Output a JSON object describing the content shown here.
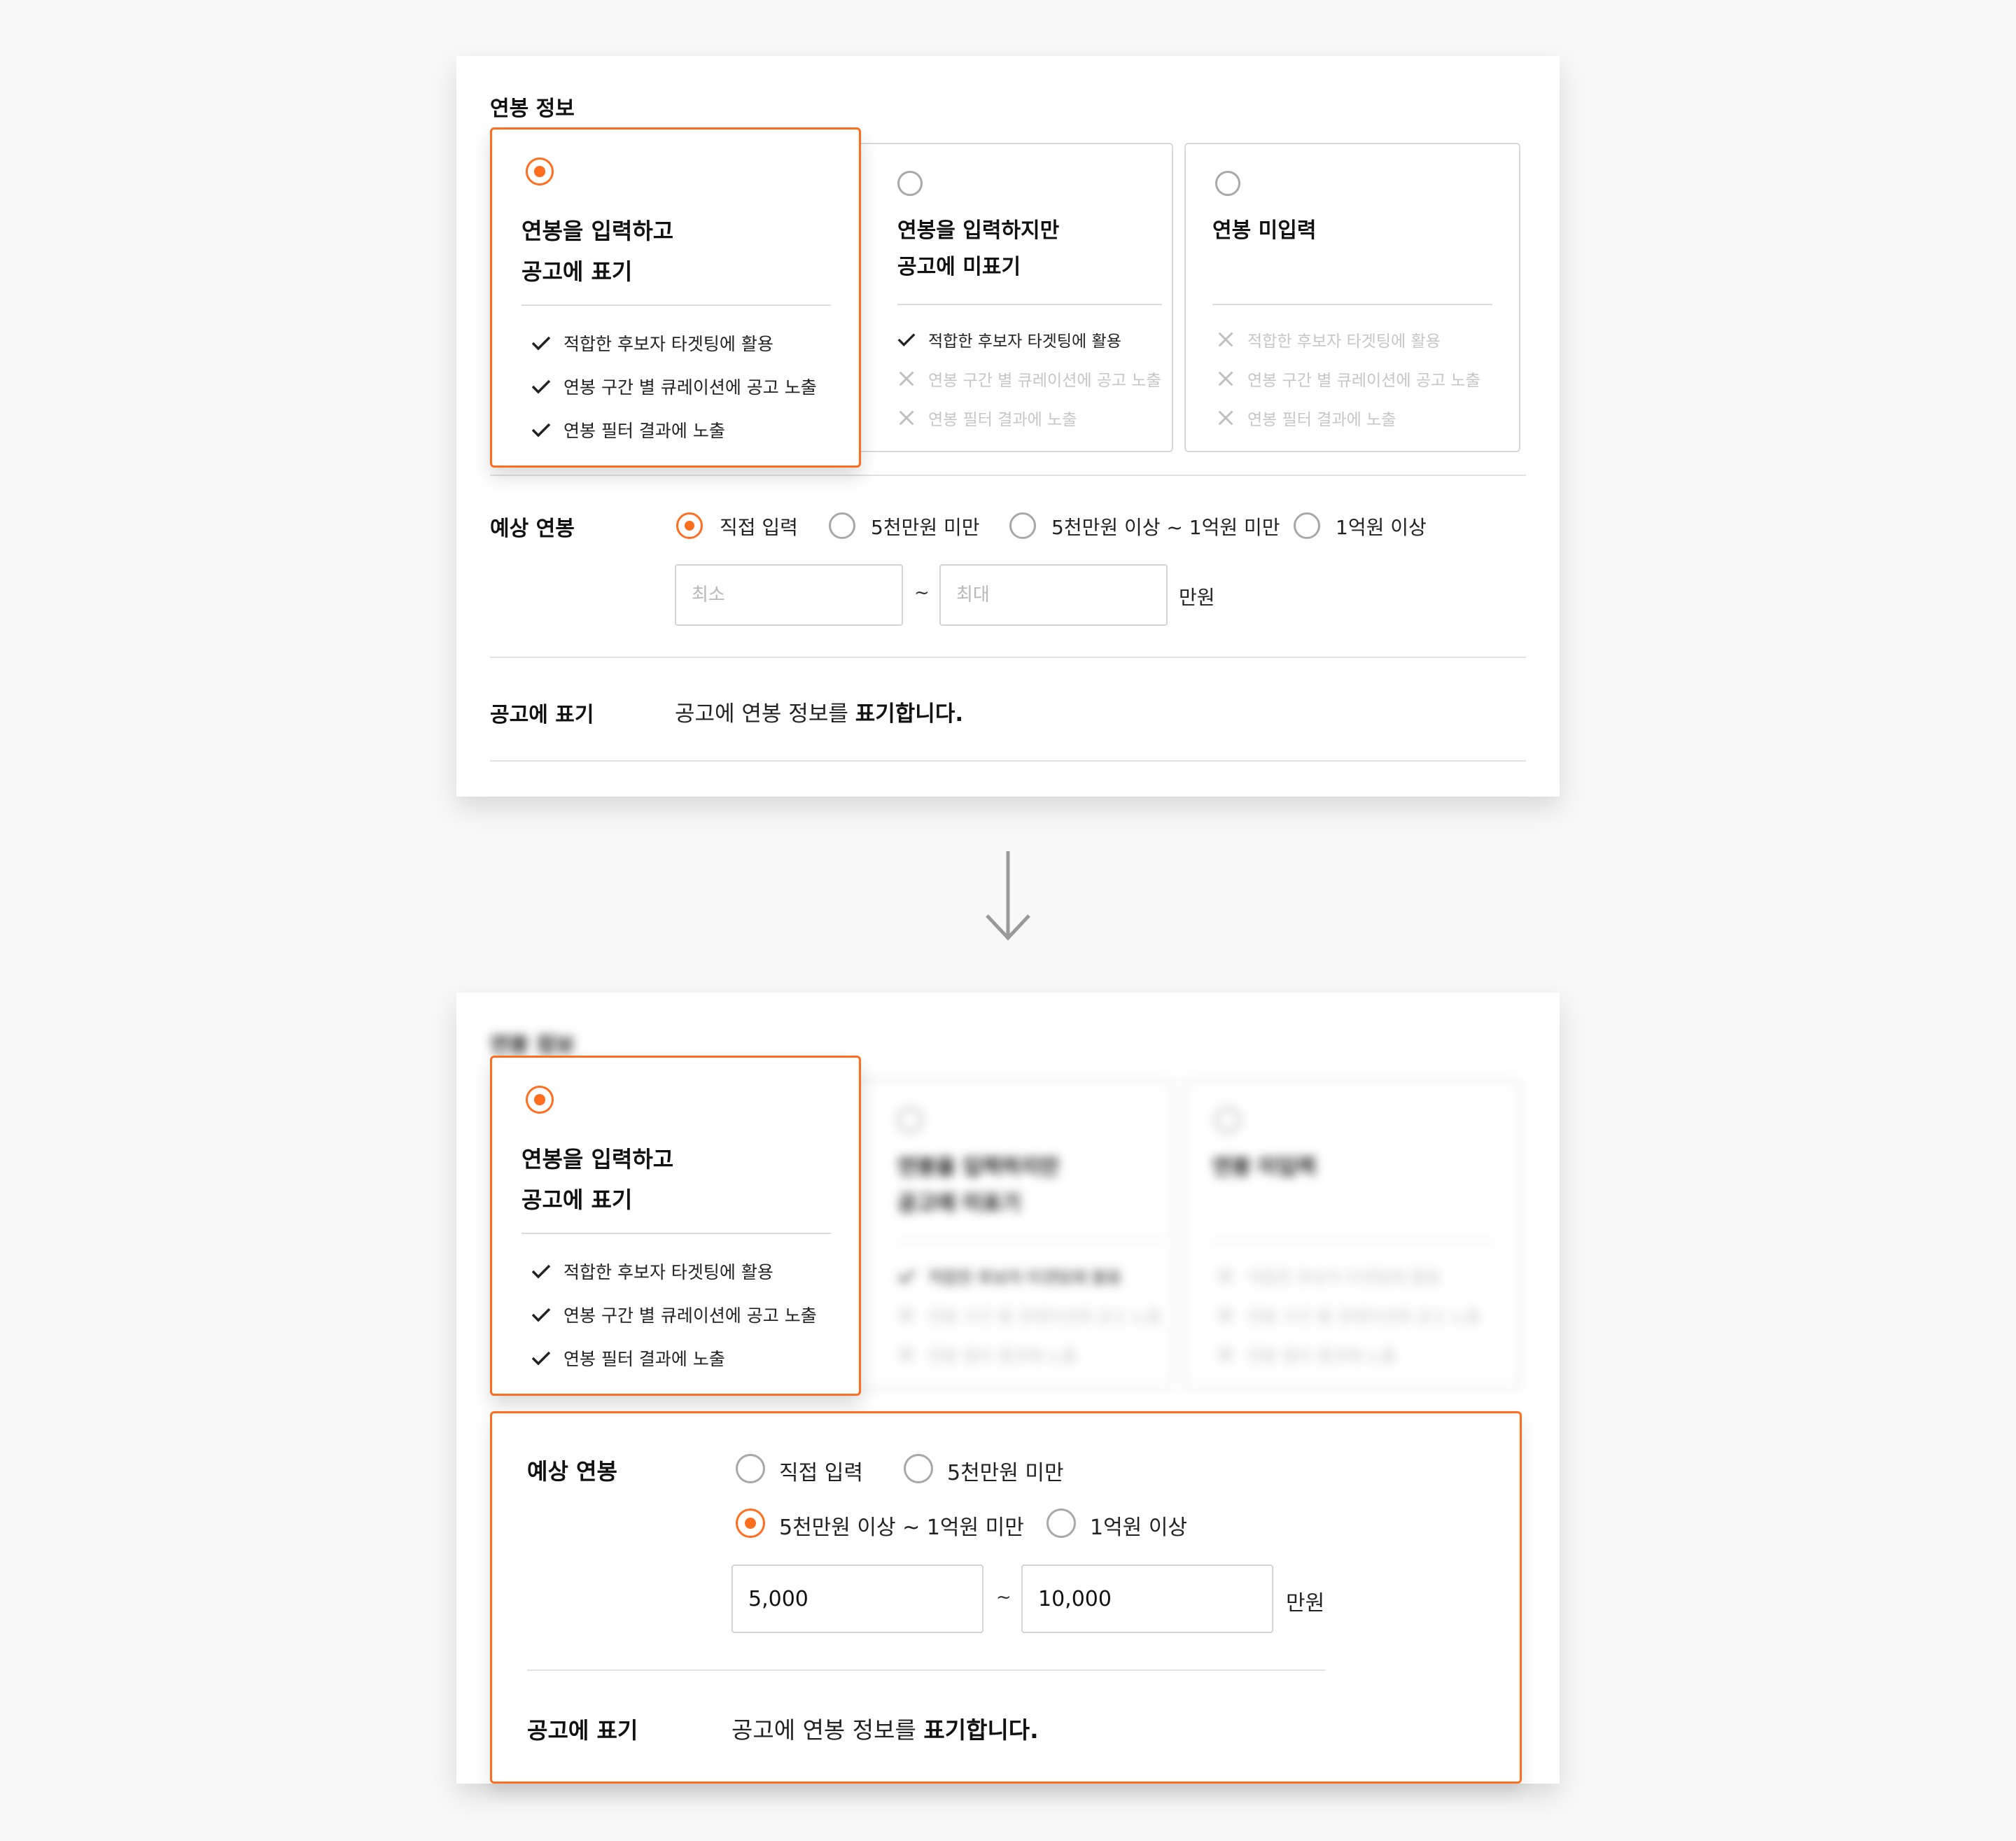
{
  "salary_info": {
    "title": "연봉 정보",
    "options": [
      {
        "title_line1": "연봉을 입력하고",
        "title_line2": "공고에 표기",
        "selected": true,
        "features": [
          {
            "text": "적합한 후보자 타겟팅에 활용",
            "enabled": true
          },
          {
            "text": "연봉 구간 별 큐레이션에 공고 노출",
            "enabled": true
          },
          {
            "text": "연봉 필터 결과에 노출",
            "enabled": true
          }
        ]
      },
      {
        "title_line1": "연봉을 입력하지만",
        "title_line2": "공고에 미표기",
        "selected": false,
        "features": [
          {
            "text": "적합한 후보자 타겟팅에 활용",
            "enabled": true
          },
          {
            "text": "연봉 구간 별 큐레이션에 공고 노출",
            "enabled": false
          },
          {
            "text": "연봉 필터 결과에 노출",
            "enabled": false
          }
        ]
      },
      {
        "title_line1": "연봉 미입력",
        "title_line2": "",
        "selected": false,
        "features": [
          {
            "text": "적합한 후보자 타겟팅에 활용",
            "enabled": false
          },
          {
            "text": "연봉 구간 별 큐레이션에 공고 노출",
            "enabled": false
          },
          {
            "text": "연봉 필터 결과에 노출",
            "enabled": false
          }
        ]
      }
    ]
  },
  "expected_salary": {
    "label": "예상 연봉",
    "options": [
      "직접 입력",
      "5천만원 미만",
      "5천만원 이상 ~ 1억원 미만",
      "1억원 이상"
    ],
    "before": {
      "selected": "직접 입력",
      "min_value": "",
      "max_value": "",
      "min_placeholder": "최소",
      "max_placeholder": "최대"
    },
    "after": {
      "selected": "5천만원 이상 ~ 1억원 미만",
      "min_value": "5,000",
      "max_value": "10,000"
    },
    "separator": "~",
    "unit": "만원"
  },
  "display": {
    "label": "공고에 표기",
    "sentence_prefix": "공고에 연봉 정보를 ",
    "sentence_bold": "표기합니다."
  },
  "colors": {
    "accent": "#ff6d1f",
    "check": "#222222",
    "disabled": "#c6c6c6",
    "background": "#f8f8f8"
  },
  "icons": {
    "check": "check-icon",
    "cross": "x-icon",
    "arrow": "arrow-down-icon"
  }
}
